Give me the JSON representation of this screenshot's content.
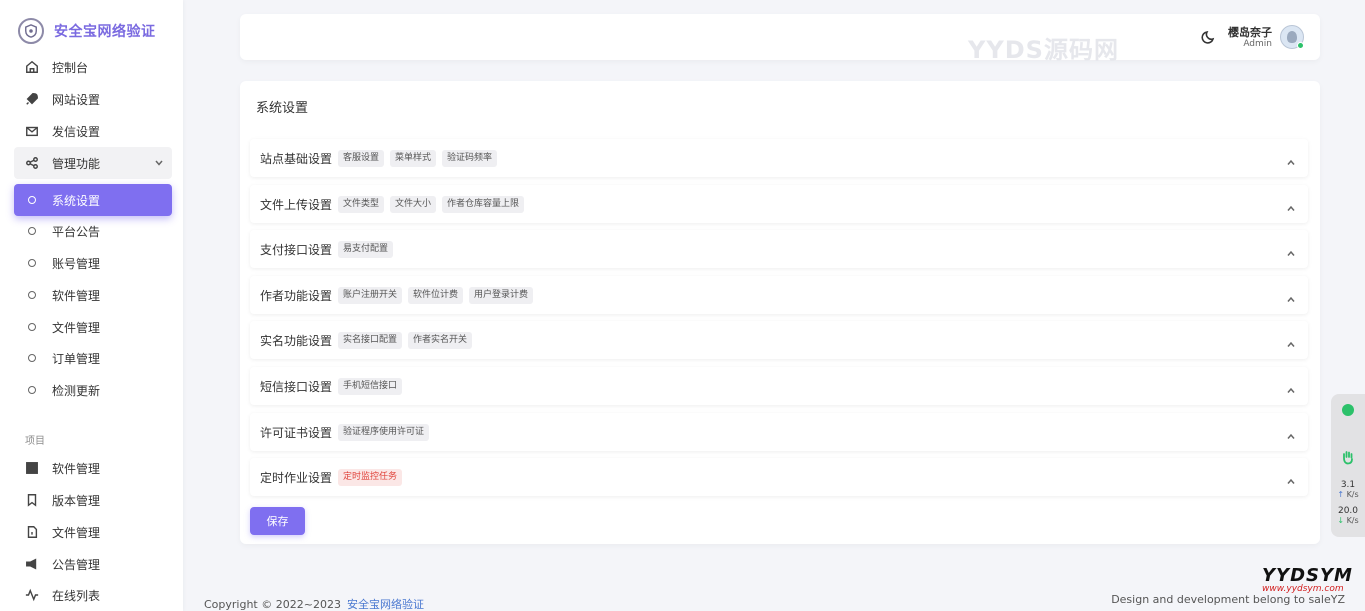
{
  "brand": {
    "title": "安全宝网络验证"
  },
  "sidebar": {
    "items": [
      {
        "label": "控制台",
        "icon": "home-icon"
      },
      {
        "label": "网站设置",
        "icon": "rocket-icon"
      },
      {
        "label": "发信设置",
        "icon": "mail-icon"
      }
    ],
    "group": {
      "label": "管理功能",
      "icon": "share-icon"
    },
    "sub_items": [
      {
        "label": "系统设置",
        "active": true
      },
      {
        "label": "平台公告"
      },
      {
        "label": "账号管理"
      },
      {
        "label": "软件管理"
      },
      {
        "label": "文件管理"
      },
      {
        "label": "订单管理"
      },
      {
        "label": "检测更新"
      }
    ],
    "section_label": "项目",
    "project_items": [
      {
        "label": "软件管理",
        "icon": "server-icon"
      },
      {
        "label": "版本管理",
        "icon": "bookmark-icon"
      },
      {
        "label": "文件管理",
        "icon": "file-icon"
      },
      {
        "label": "公告管理",
        "icon": "megaphone-icon"
      },
      {
        "label": "在线列表",
        "icon": "activity-icon"
      }
    ]
  },
  "header": {
    "watermark": "YYDS源码网",
    "user_name": "樱岛奈子",
    "user_role": "Admin"
  },
  "main": {
    "title": "系统设置",
    "rows": [
      {
        "title": "站点基础设置",
        "tags": [
          "客服设置",
          "菜单样式",
          "验证码频率"
        ]
      },
      {
        "title": "文件上传设置",
        "tags": [
          "文件类型",
          "文件大小",
          "作者仓库容量上限"
        ]
      },
      {
        "title": "支付接口设置",
        "tags": [
          "易支付配置"
        ]
      },
      {
        "title": "作者功能设置",
        "tags": [
          "账户注册开关",
          "软件位计费",
          "用户登录计费"
        ]
      },
      {
        "title": "实名功能设置",
        "tags": [
          "实名接口配置",
          "作者实名开关"
        ]
      },
      {
        "title": "短信接口设置",
        "tags": [
          "手机短信接口"
        ]
      },
      {
        "title": "许可证书设置",
        "tags": [
          "验证程序使用许可证"
        ]
      },
      {
        "title": "定时作业设置",
        "tags": [
          "定时监控任务"
        ],
        "tag_style": "red"
      }
    ],
    "save_label": "保存"
  },
  "footer": {
    "copyright": "Copyright © 2022~2023",
    "brand_link": "安全宝网络验证",
    "right_text": "Design and development belong to saleYZ"
  },
  "widget": {
    "upload_speed": "3.1",
    "upload_unit": "K/s",
    "download_speed": "20.0",
    "download_unit": "K/s"
  },
  "corner_logo": {
    "main": "YYDSYM",
    "sub": "www.yydsym.com"
  },
  "colors": {
    "accent": "#7f6ff0",
    "status_green": "#2cc16a",
    "tag_red": "#e0443c",
    "link": "#4a78d0"
  }
}
